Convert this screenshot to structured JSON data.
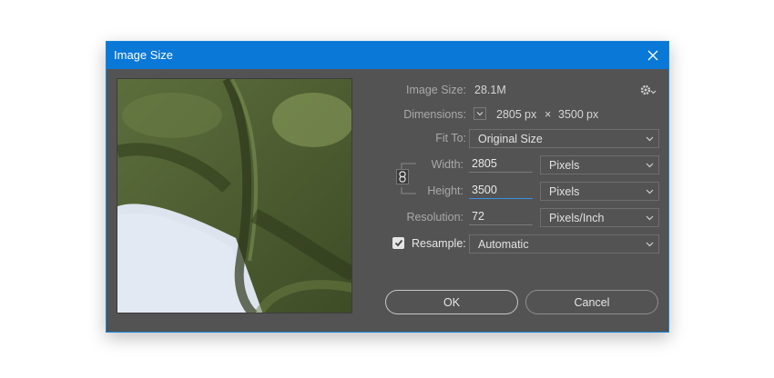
{
  "window": {
    "title": "Image Size"
  },
  "info": {
    "image_size_label": "Image Size:",
    "image_size_value": "28.1M",
    "dimensions_label": "Dimensions:",
    "dim_width": "2805",
    "dim_unit_w": "px",
    "dim_x": "×",
    "dim_height": "3500",
    "dim_unit_h": "px"
  },
  "fit_to": {
    "label": "Fit To:",
    "value": "Original Size"
  },
  "width": {
    "label": "Width:",
    "value": "2805",
    "unit": "Pixels"
  },
  "height": {
    "label": "Height:",
    "value": "3500",
    "unit": "Pixels"
  },
  "resolution": {
    "label": "Resolution:",
    "value": "72",
    "unit": "Pixels/Inch"
  },
  "resample": {
    "label": "Resample:",
    "checked": true,
    "value": "Automatic"
  },
  "buttons": {
    "ok": "OK",
    "cancel": "Cancel"
  },
  "icons": {
    "close": "close-icon",
    "gear": "gear-icon",
    "chain": "chain-link-icon",
    "chevron": "chevron-down-icon",
    "check": "checkmark-icon"
  },
  "colors": {
    "titlebar": "#0a78d7",
    "dialog_bg": "#535353",
    "focus_underline": "#3a8fe0"
  }
}
